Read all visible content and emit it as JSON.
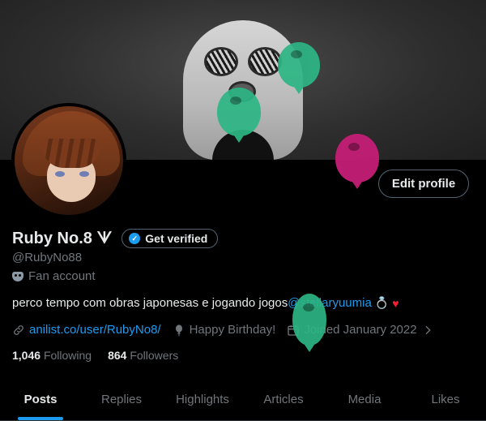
{
  "profile": {
    "display_name": "Ruby No.8 ᗐ",
    "get_verified_label": "Get verified",
    "handle": "@RubyNo88",
    "account_type": "Fan account",
    "edit_profile_label": "Edit profile",
    "bio_text": "perco tempo com obras japonesas e jogando jogos ",
    "bio_mention": "@stellaryuumia",
    "bio_emoji_1": "💍",
    "bio_emoji_2": "♥",
    "link": "anilist.co/user/RubyNo8/",
    "birthday": "Happy Birthday!",
    "joined": "Joined January 2022",
    "following_count": "1,046",
    "following_label": "Following",
    "followers_count": "864",
    "followers_label": "Followers"
  },
  "tabs": [
    {
      "label": "Posts",
      "active": true
    },
    {
      "label": "Replies"
    },
    {
      "label": "Highlights"
    },
    {
      "label": "Articles"
    },
    {
      "label": "Media"
    },
    {
      "label": "Likes"
    }
  ],
  "icons": {
    "verified": "verified-badge-icon",
    "fan": "mask-icon",
    "link": "link-icon",
    "birthday": "balloon-icon",
    "calendar": "calendar-icon",
    "chevron": "chevron-right-icon"
  },
  "colors": {
    "accent": "#1d9bf0",
    "text_primary": "#e7e9ea",
    "text_secondary": "#71767b",
    "background": "#000000",
    "balloon_green": "#2db685",
    "balloon_pink": "#c41e75"
  }
}
